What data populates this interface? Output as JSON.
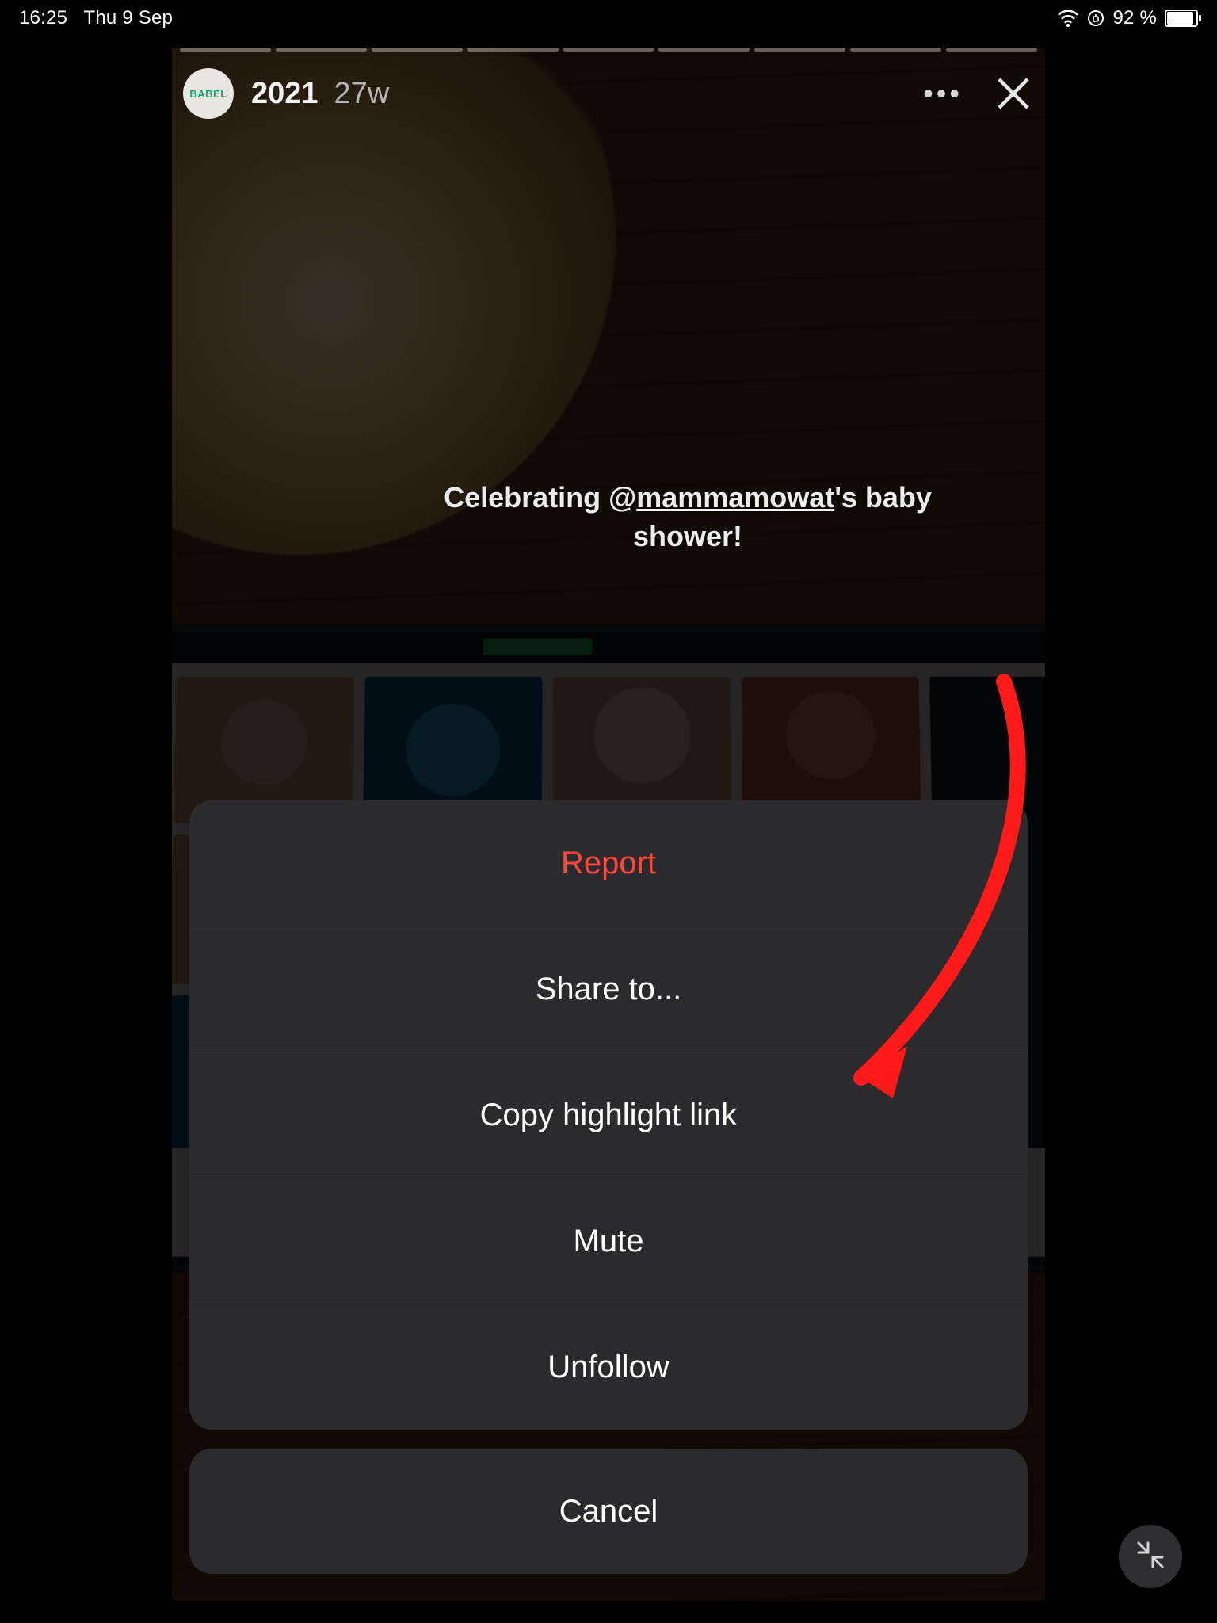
{
  "statusbar": {
    "time": "16:25",
    "date": "Thu 9 Sep",
    "battery_text": "92 %",
    "battery_level": 0.92
  },
  "story": {
    "avatar_label": "BABEL",
    "title": "2021",
    "age": "27w",
    "segments_total": 9,
    "segment_progress": 0.0,
    "caption_prefix": "Celebrating @",
    "caption_mention": "mammamowat",
    "caption_suffix": "'s baby shower!"
  },
  "actionSheet": {
    "items": [
      {
        "label": "Report",
        "destructive": true
      },
      {
        "label": "Share to..."
      },
      {
        "label": "Copy highlight link"
      },
      {
        "label": "Mute"
      },
      {
        "label": "Unfollow"
      }
    ],
    "cancel": "Cancel"
  },
  "annotation": {
    "arrow_color": "#ff1a1a"
  }
}
